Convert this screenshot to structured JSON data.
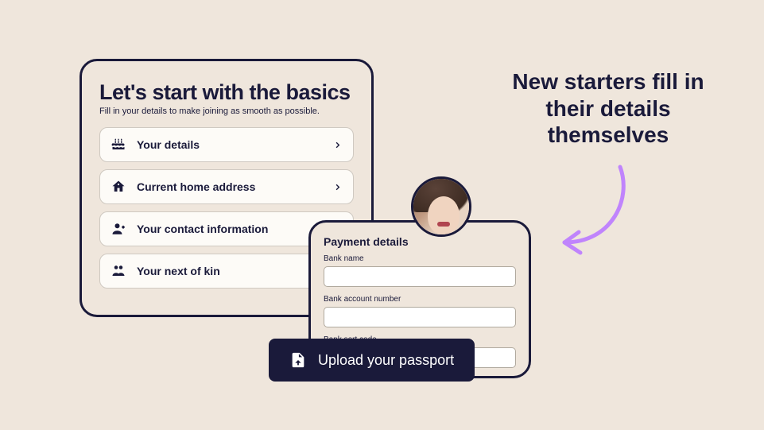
{
  "basics": {
    "heading": "Let's start with the basics",
    "subtitle": "Fill in your details to make joining as smooth as possible.",
    "rows": [
      {
        "label": "Your details",
        "icon": "cake-icon"
      },
      {
        "label": "Current home address",
        "icon": "home-icon"
      },
      {
        "label": "Your contact information",
        "icon": "contact-icon"
      },
      {
        "label": "Your next of kin",
        "icon": "kin-icon"
      }
    ]
  },
  "payment": {
    "heading": "Payment details",
    "fields": [
      {
        "label": "Bank name"
      },
      {
        "label": "Bank account number"
      },
      {
        "label": "Bank sort code"
      }
    ]
  },
  "upload_label": "Upload your passport",
  "headline": "New starters fill in their details themselves",
  "colors": {
    "text": "#1a1a3a",
    "bg": "#efe6dc",
    "arrow": "#c084fc"
  }
}
